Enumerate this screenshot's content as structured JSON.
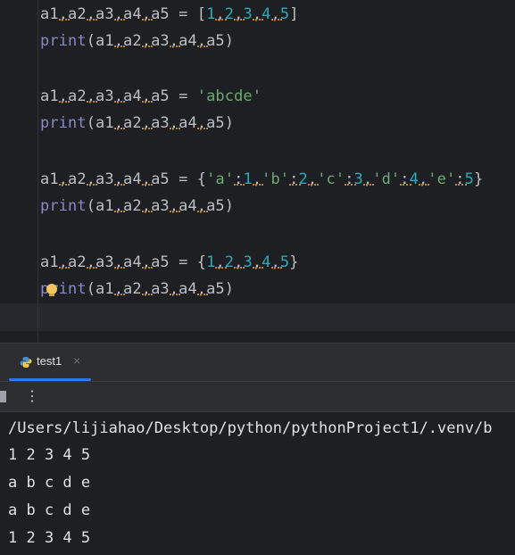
{
  "editor": {
    "lines": [
      {
        "vars": [
          "a1",
          "a2",
          "a3",
          "a4",
          "a5"
        ],
        "assign": " = ",
        "open": "[",
        "items": [
          "1",
          "2",
          "3",
          "4",
          "5"
        ],
        "close": "]",
        "item_kind": "num"
      },
      {
        "call": "print",
        "args": [
          "a1",
          "a2",
          "a3",
          "a4",
          "a5"
        ]
      },
      {
        "vars": [
          "a1",
          "a2",
          "a3",
          "a4",
          "a5"
        ],
        "assign": " = ",
        "literal": "'abcde'",
        "item_kind": "str"
      },
      {
        "call": "print",
        "args": [
          "a1",
          "a2",
          "a3",
          "a4",
          "a5"
        ]
      },
      {
        "vars": [
          "a1",
          "a2",
          "a3",
          "a4",
          "a5"
        ],
        "assign": " = ",
        "open": "{",
        "pairs": [
          [
            "'a'",
            "1"
          ],
          [
            "'b'",
            "2"
          ],
          [
            "'c'",
            "3"
          ],
          [
            "'d'",
            "4"
          ],
          [
            "'e'",
            "5"
          ]
        ],
        "close": "}"
      },
      {
        "call": "print",
        "args": [
          "a1",
          "a2",
          "a3",
          "a4",
          "a5"
        ]
      },
      {
        "vars": [
          "a1",
          "a2",
          "a3",
          "a4",
          "a5"
        ],
        "assign": " = ",
        "open": "{",
        "items": [
          "1",
          "2",
          "3",
          "4",
          "5"
        ],
        "close": "}",
        "item_kind": "num"
      },
      {
        "call": "print",
        "args": [
          "a1",
          "a2",
          "a3",
          "a4",
          "a5"
        ],
        "bulb": true
      }
    ]
  },
  "run_panel": {
    "tab_label": "test1",
    "tab_close": "×",
    "more_icon": "⋮",
    "output": [
      "/Users/lijiahao/Desktop/python/pythonProject1/.venv/b",
      "1 2 3 4 5",
      "a b c d e",
      "a b c d e",
      "1 2 3 4 5"
    ]
  },
  "colors": {
    "background": "#1e1f22",
    "keyword_print": "#8888c6",
    "number": "#2aacb8",
    "string": "#6aab73",
    "text": "#bcbec4",
    "tab_accent": "#3574f0"
  }
}
